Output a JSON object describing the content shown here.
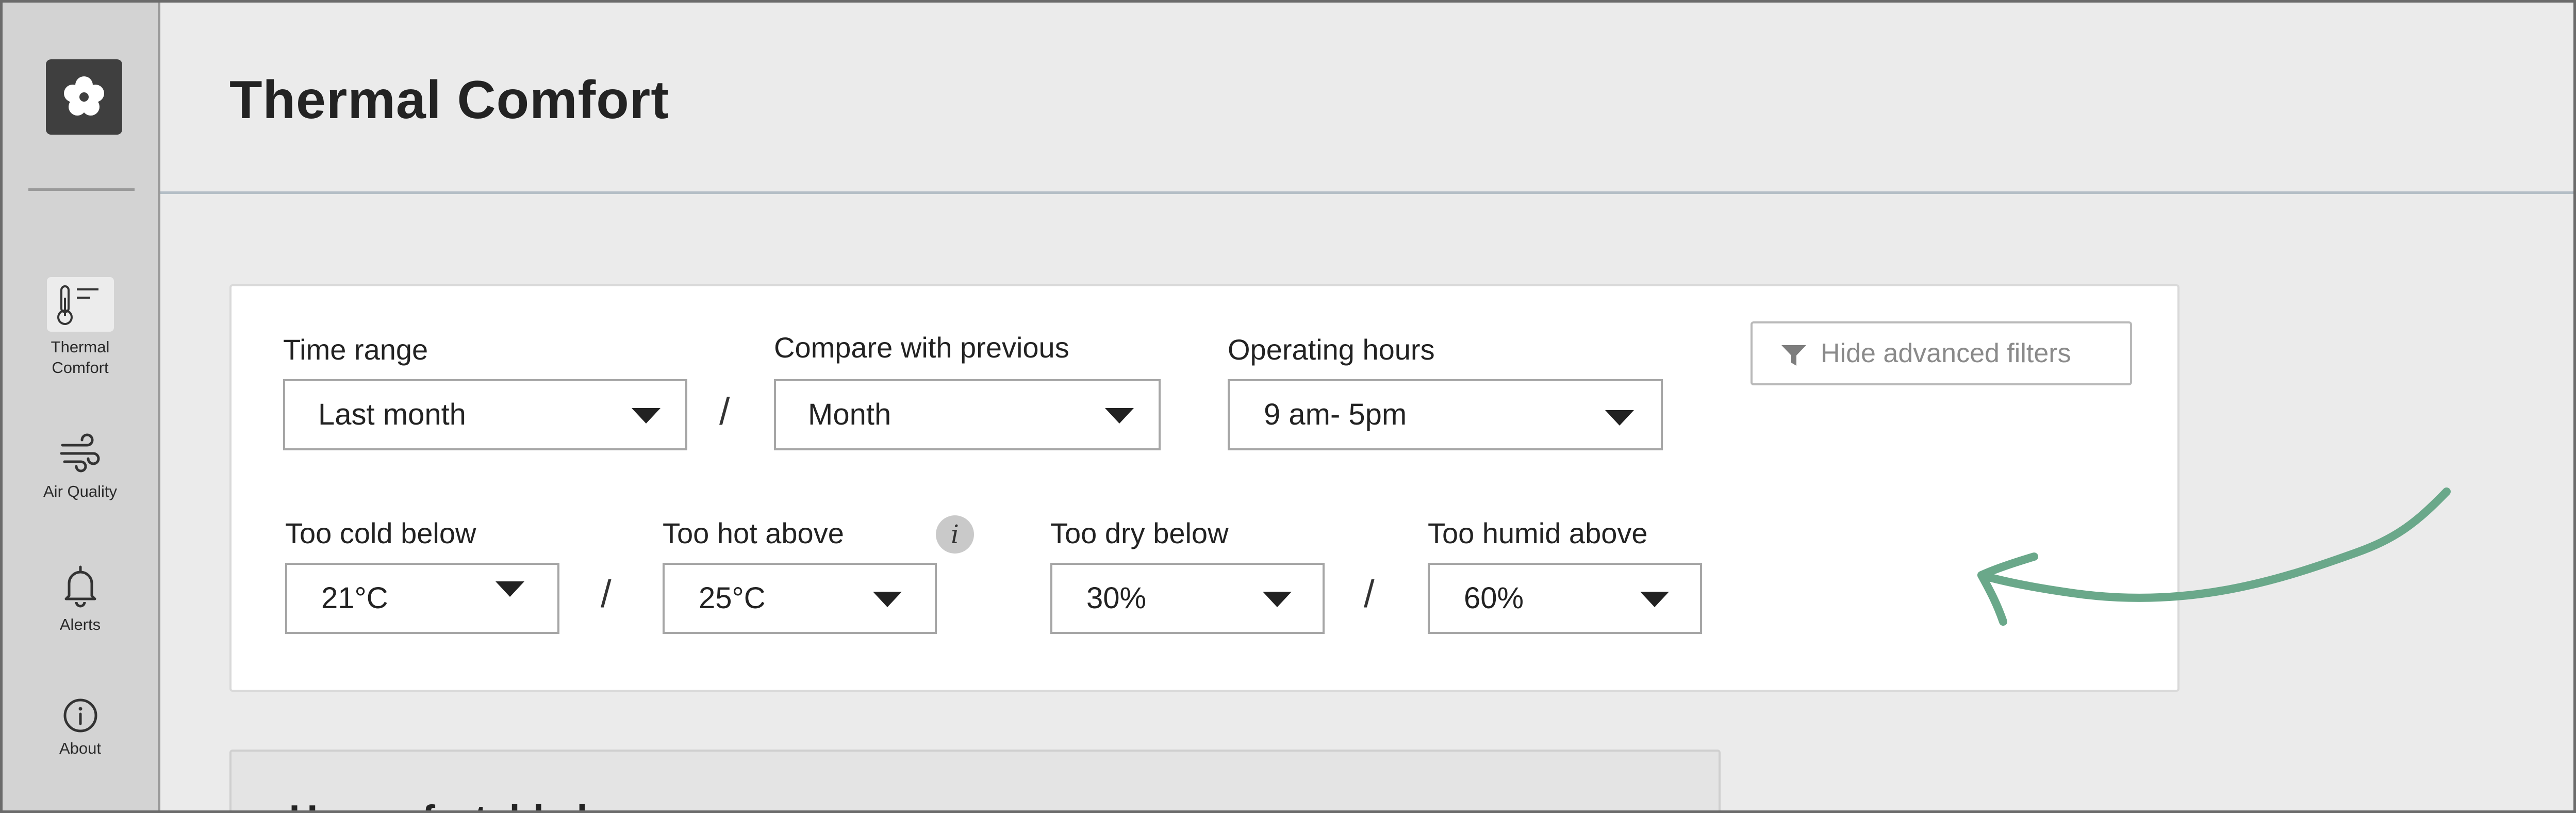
{
  "app": {
    "page_title": "Thermal Comfort",
    "accent_color": "#6aa88a"
  },
  "sidebar": {
    "logo_icon": "flower-icon",
    "items": [
      {
        "label": "Thermal\nComfort",
        "line1": "Thermal",
        "line2": "Comfort",
        "icon": "thermometer-icon",
        "active": true
      },
      {
        "label": "Air Quality",
        "icon": "wind-icon",
        "active": false
      },
      {
        "label": "Alerts",
        "icon": "bell-icon",
        "active": false
      },
      {
        "label": "About",
        "icon": "info-icon",
        "active": false
      }
    ]
  },
  "filters": {
    "time_range": {
      "label": "Time range",
      "value": "Last month"
    },
    "compare": {
      "label": "Compare with previous",
      "value": "Month"
    },
    "operating_hours": {
      "label": "Operating hours",
      "value": "9 am- 5pm"
    },
    "too_cold": {
      "label": "Too cold below",
      "value": "21°C"
    },
    "too_hot": {
      "label": "Too hot above",
      "value": "25°C"
    },
    "too_dry": {
      "label": "Too dry below",
      "value": "30%"
    },
    "too_humid": {
      "label": "Too humid above",
      "value": "60%"
    },
    "separator": "/",
    "info_glyph": "i",
    "hide_advanced_label": "Hide advanced filters"
  },
  "second_card": {
    "title_partial": "Uncomfortable h"
  }
}
